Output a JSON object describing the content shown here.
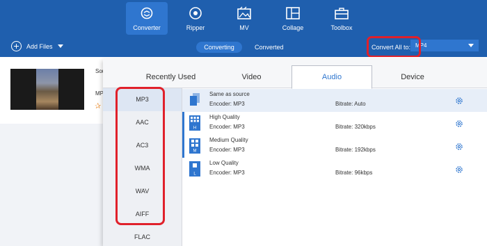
{
  "nav": {
    "items": [
      {
        "label": "Converter",
        "icon": "converter-icon",
        "active": true
      },
      {
        "label": "Ripper",
        "icon": "ripper-icon"
      },
      {
        "label": "MV",
        "icon": "mv-icon"
      },
      {
        "label": "Collage",
        "icon": "collage-icon"
      },
      {
        "label": "Toolbox",
        "icon": "toolbox-icon"
      }
    ]
  },
  "subbar": {
    "add_files": "Add Files",
    "tab_converting": "Converting",
    "tab_converted": "Converted",
    "convert_all_label": "Convert All to:",
    "convert_all_value": "MP4"
  },
  "file": {
    "source_prefix": "Sou",
    "format_prefix": "MP"
  },
  "panel": {
    "tabs": [
      "Recently Used",
      "Video",
      "Audio",
      "Device"
    ],
    "active_tab": "Audio",
    "formats": [
      "MP3",
      "AAC",
      "AC3",
      "WMA",
      "WAV",
      "AIFF",
      "FLAC"
    ],
    "selected_format": "MP3",
    "qualities": [
      {
        "title": "Same as source",
        "encoder": "Encoder: MP3",
        "bitrate": "Bitrate: Auto",
        "badge": ""
      },
      {
        "title": "High Quality",
        "encoder": "Encoder: MP3",
        "bitrate": "Bitrate: 320kbps",
        "badge": "H"
      },
      {
        "title": "Medium Quality",
        "encoder": "Encoder: MP3",
        "bitrate": "Bitrate: 192kbps",
        "badge": "M"
      },
      {
        "title": "Low Quality",
        "encoder": "Encoder: MP3",
        "bitrate": "Bitrate: 96kbps",
        "badge": "L"
      }
    ]
  },
  "colors": {
    "nav_bg": "#1f5fae",
    "accent": "#2f76cf",
    "highlight_red": "#e0202a"
  }
}
